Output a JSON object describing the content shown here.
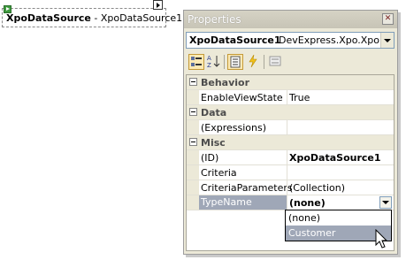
{
  "designer": {
    "control_type": "XpoDataSource",
    "control_separator": " - ",
    "control_name": "XpoDataSource1"
  },
  "properties": {
    "title": "Properties",
    "object_name": "XpoDataSource1",
    "object_type": "DevExpress.Xpo.XpoDat",
    "toolbar": [
      "categorized-icon",
      "alphabetical-icon",
      "properties-icon",
      "events-icon",
      "property-pages-icon"
    ],
    "grid": [
      {
        "kind": "category",
        "label": "Behavior"
      },
      {
        "kind": "prop",
        "label": "EnableViewState",
        "value": "True"
      },
      {
        "kind": "category",
        "label": "Data"
      },
      {
        "kind": "prop",
        "label": "(Expressions)",
        "value": ""
      },
      {
        "kind": "category",
        "label": "Misc"
      },
      {
        "kind": "prop",
        "label": "(ID)",
        "value": "XpoDataSource1",
        "bold": true
      },
      {
        "kind": "prop",
        "label": "Criteria",
        "value": ""
      },
      {
        "kind": "prop",
        "label": "CriteriaParameters",
        "value": "(Collection)"
      },
      {
        "kind": "prop",
        "label": "TypeName",
        "value": "(none)",
        "bold": true,
        "selected": true
      }
    ],
    "dropdown": {
      "options": [
        "(none)",
        "Customer"
      ],
      "highlighted": "Customer"
    }
  },
  "colors": {
    "selection": "#9fa7b7",
    "category_bg": "#ece9d8"
  }
}
